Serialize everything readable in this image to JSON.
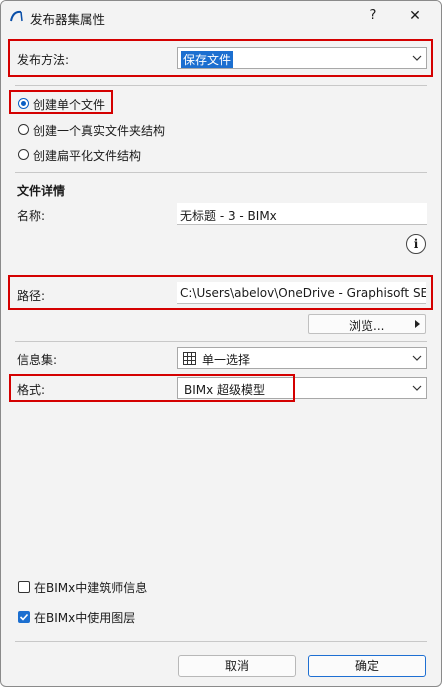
{
  "window": {
    "title": "发布器集属性",
    "help_label": "?",
    "close_label": "✕"
  },
  "publish_method": {
    "label": "发布方法:",
    "value": "保存文件"
  },
  "structure_options": [
    {
      "label": "创建单个文件",
      "selected": true
    },
    {
      "label": "创建一个真实文件夹结构",
      "selected": false
    },
    {
      "label": "创建扁平化文件结构",
      "selected": false
    }
  ],
  "file_details": {
    "heading": "文件详情",
    "name_label": "名称:",
    "name_value": "无标题 - 3 - BIMx",
    "info_label": "i",
    "path_label": "路径:",
    "path_value": "C:\\Users\\abelov\\OneDrive - Graphisoft SE",
    "browse_label": "浏览..."
  },
  "info_set": {
    "label": "信息集:",
    "value": "单一选择",
    "icon": "grid-icon"
  },
  "format": {
    "label": "格式:",
    "value": "BIMx 超级模型"
  },
  "options": [
    {
      "label": "在BIMx中建筑师信息",
      "checked": false
    },
    {
      "label": "在BIMx中使用图层",
      "checked": true
    }
  ],
  "buttons": {
    "cancel": "取消",
    "ok": "确定"
  },
  "colors": {
    "highlight": "#d40000",
    "accent": "#0a5fc4",
    "selection": "#1c6fd0"
  }
}
